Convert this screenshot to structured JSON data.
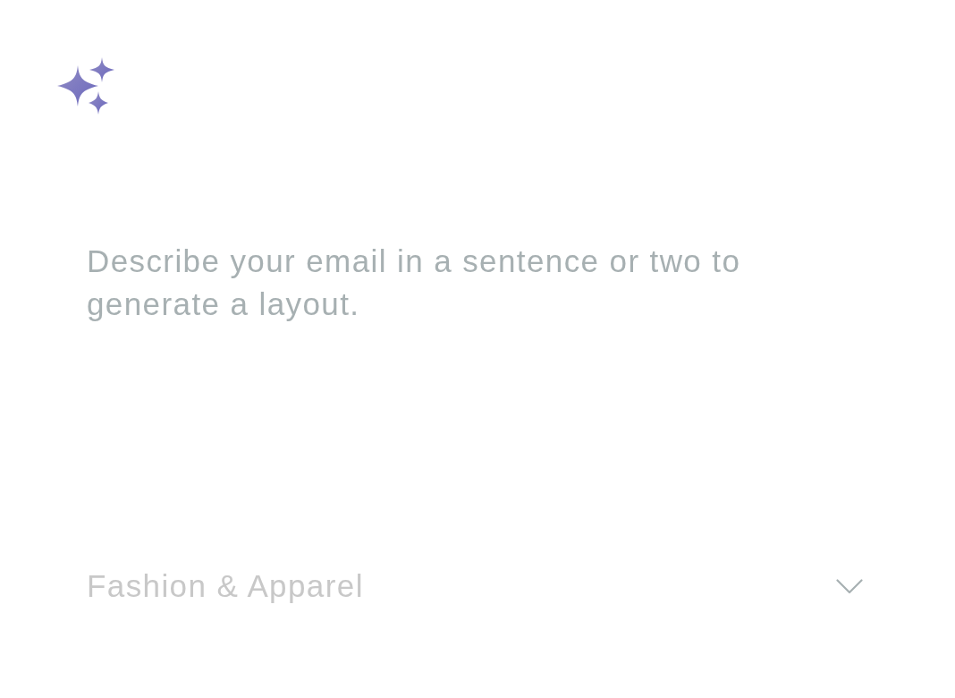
{
  "prompt": {
    "placeholder": "Describe your email in a sentence or two to generate a layout."
  },
  "industry_dropdown": {
    "placeholder": "Fashion & Apparel",
    "expanded": false
  }
}
